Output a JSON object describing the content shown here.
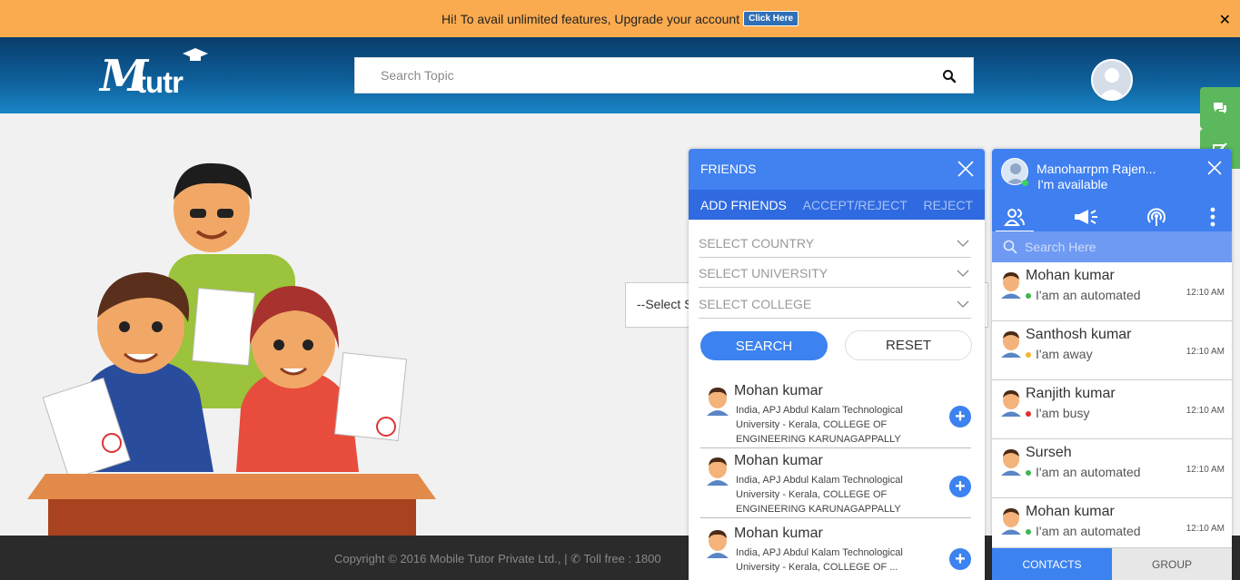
{
  "promo": {
    "text": "Hi! To avail unlimited features, Upgrade your account",
    "button": "Click Here",
    "close": "✕"
  },
  "header": {
    "logo_m": "M",
    "logo_rest": "tutr",
    "search_placeholder": "Search Topic"
  },
  "main": {
    "select_text": "--Select S"
  },
  "footer": {
    "copyright": "Copyright © 2016 Mobile Tutor Private Ltd., | ✆ Toll free : 1800"
  },
  "friends": {
    "title": "FRIENDS",
    "tabs": [
      "ADD FRIENDS",
      "ACCEPT/REJECT",
      "REJECT"
    ],
    "selects": [
      "SELECT COUNTRY",
      "SELECT UNIVERSITY",
      "SELECT COLLEGE"
    ],
    "search_label": "SEARCH",
    "reset_label": "RESET",
    "items": [
      {
        "name": "Mohan kumar",
        "desc": "India, APJ Abdul Kalam Technological University - Kerala, COLLEGE OF ENGINEERING KARUNAGAPPALLY"
      },
      {
        "name": "Mohan kumar",
        "desc": "India, APJ Abdul Kalam Technological University - Kerala, COLLEGE OF ENGINEERING KARUNAGAPPALLY"
      },
      {
        "name": "Mohan kumar",
        "desc": "India, APJ Abdul Kalam Technological University - Kerala, COLLEGE OF ..."
      }
    ]
  },
  "chat": {
    "user_name": "Manoharrpm Rajen...",
    "user_status": "I'm available",
    "search_placeholder": "Search Here",
    "contacts": [
      {
        "name": "Mohan kumar",
        "status": "I'am an automated",
        "time": "12:10 AM",
        "dot": "#3fb650"
      },
      {
        "name": "Santhosh kumar",
        "status": "I'am away",
        "time": "12:10 AM",
        "dot": "#f2b630"
      },
      {
        "name": "Ranjith kumar",
        "status": "I'am busy",
        "time": "12:10 AM",
        "dot": "#e0302a"
      },
      {
        "name": "Surseh",
        "status": "I'am an automated",
        "time": "12:10 AM",
        "dot": "#3fb650"
      },
      {
        "name": "Mohan kumar",
        "status": "I'am an automated",
        "time": "12:10 AM",
        "dot": "#3fb650"
      }
    ],
    "bottom_tabs": [
      "CONTACTS",
      "GROUP"
    ]
  },
  "colors": {
    "promo_bg": "#fbab4f",
    "header_blue": "#0e5e99",
    "panel_blue": "#4182f0",
    "green_tab": "#5cb85c"
  }
}
